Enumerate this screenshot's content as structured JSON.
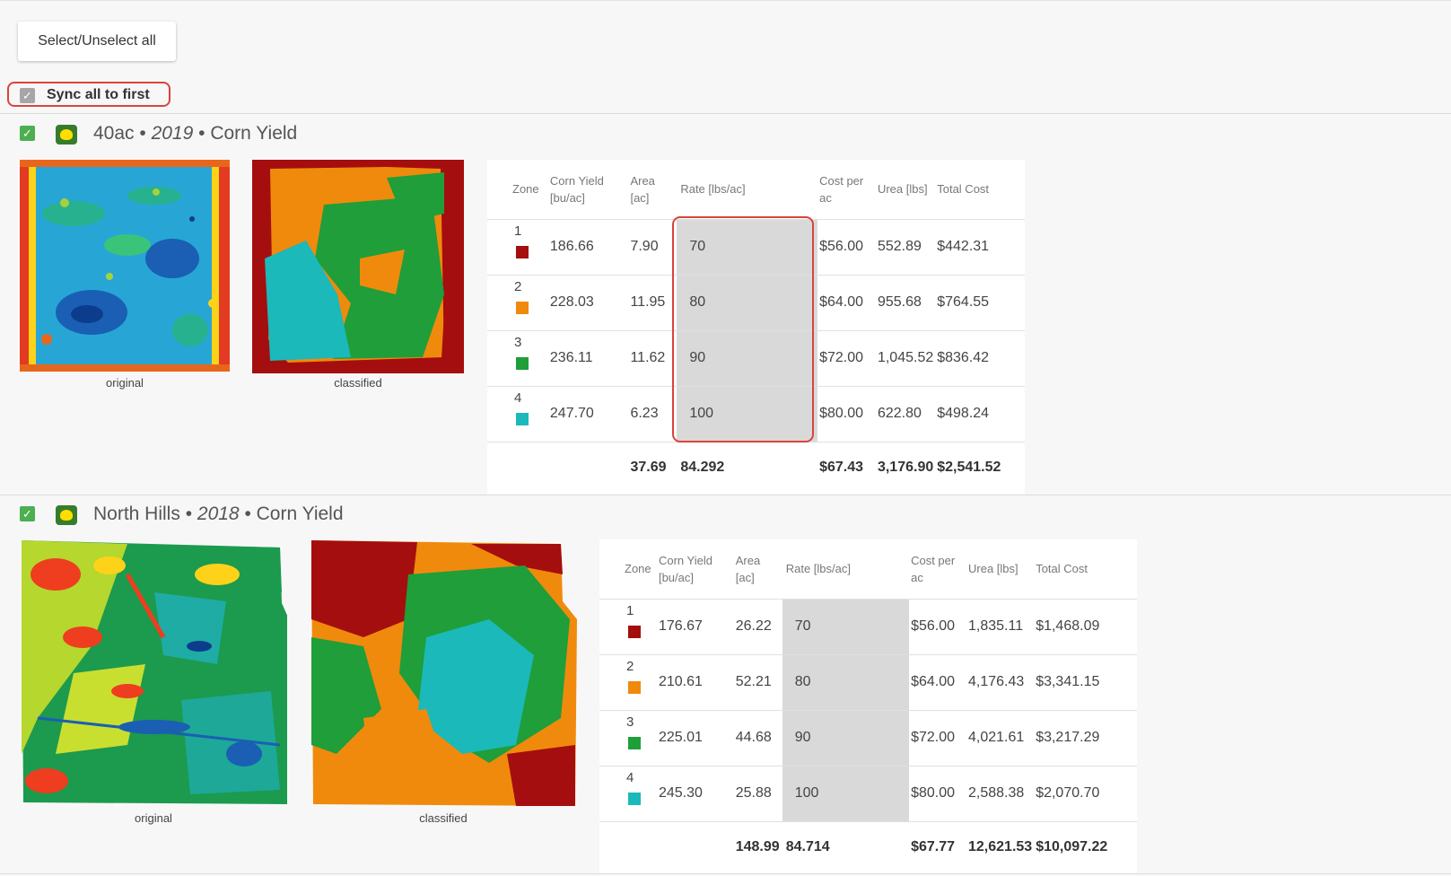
{
  "toolbar": {
    "select_all_label": "Select/Unselect all"
  },
  "sync": {
    "label": "Sync all to first",
    "checked": true
  },
  "columns": {
    "zone": "Zone",
    "yield": "Corn Yield [bu/ac]",
    "area": "Area [ac]",
    "rate": "Rate [lbs/ac]",
    "cost_per_ac": "Cost per ac",
    "urea": "Urea [lbs]",
    "total_cost": "Total Cost"
  },
  "zone_colors": [
    "#a50e0e",
    "#f08a0c",
    "#1f9e3a",
    "#1bb9b9"
  ],
  "fields": [
    {
      "name": "40ac",
      "sep1": " • ",
      "year": "2019",
      "sep2": " • ",
      "layer": "Corn Yield",
      "original_caption": "original",
      "classified_caption": "classified",
      "rows": [
        {
          "zone": "1",
          "yield": "186.66",
          "area": "7.90",
          "rate": "70",
          "cost_per_ac": "$56.00",
          "urea": "552.89",
          "total_cost": "$442.31"
        },
        {
          "zone": "2",
          "yield": "228.03",
          "area": "11.95",
          "rate": "80",
          "cost_per_ac": "$64.00",
          "urea": "955.68",
          "total_cost": "$764.55"
        },
        {
          "zone": "3",
          "yield": "236.11",
          "area": "11.62",
          "rate": "90",
          "cost_per_ac": "$72.00",
          "urea": "1,045.52",
          "total_cost": "$836.42"
        },
        {
          "zone": "4",
          "yield": "247.70",
          "area": "6.23",
          "rate": "100",
          "cost_per_ac": "$80.00",
          "urea": "622.80",
          "total_cost": "$498.24"
        }
      ],
      "totals": {
        "area": "37.69",
        "rate": "84.292",
        "cost_per_ac": "$67.43",
        "urea": "3,176.90",
        "total_cost": "$2,541.52"
      }
    },
    {
      "name": "North Hills",
      "sep1": " • ",
      "year": "2018",
      "sep2": " • ",
      "layer": "Corn Yield",
      "original_caption": "original",
      "classified_caption": "classified",
      "rows": [
        {
          "zone": "1",
          "yield": "176.67",
          "area": "26.22",
          "rate": "70",
          "cost_per_ac": "$56.00",
          "urea": "1,835.11",
          "total_cost": "$1,468.09"
        },
        {
          "zone": "2",
          "yield": "210.61",
          "area": "52.21",
          "rate": "80",
          "cost_per_ac": "$64.00",
          "urea": "4,176.43",
          "total_cost": "$3,341.15"
        },
        {
          "zone": "3",
          "yield": "225.01",
          "area": "44.68",
          "rate": "90",
          "cost_per_ac": "$72.00",
          "urea": "4,021.61",
          "total_cost": "$3,217.29"
        },
        {
          "zone": "4",
          "yield": "245.30",
          "area": "25.88",
          "rate": "100",
          "cost_per_ac": "$80.00",
          "urea": "2,588.38",
          "total_cost": "$2,070.70"
        }
      ],
      "totals": {
        "area": "148.99",
        "rate": "84.714",
        "cost_per_ac": "$67.77",
        "urea": "12,621.53",
        "total_cost": "$10,097.22"
      }
    }
  ]
}
